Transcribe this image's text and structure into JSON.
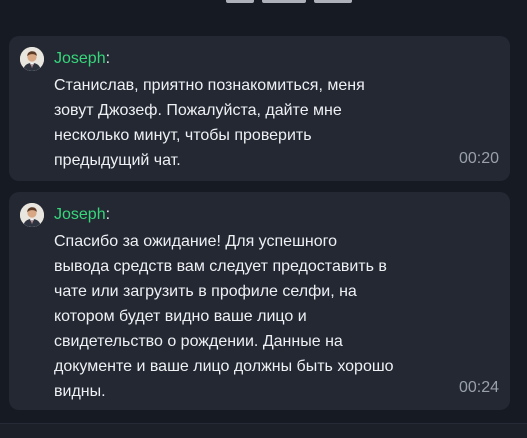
{
  "colors": {
    "background": "#151a23",
    "bubble": "#232833",
    "sender_name": "#37d67a",
    "message_text": "#eef0f3",
    "timestamp": "#9aa0aa"
  },
  "messages": [
    {
      "avatar_icon": "user-avatar-icon",
      "sender": "Joseph",
      "separator": ":",
      "lines": [
        "Станислав, приятно познакомиться, меня",
        "зовут Джозеф. Пожалуйста, дайте мне",
        "несколько минут, чтобы проверить",
        "предыдущий чат."
      ],
      "time": "00:20"
    },
    {
      "avatar_icon": "user-avatar-icon",
      "sender": "Joseph",
      "separator": ":",
      "lines": [
        "Спасибо за ожидание! Для успешного",
        "вывода средств вам следует предоставить в",
        "чате или загрузить в профиле селфи, на",
        "котором будет видно ваше лицо и",
        "свидетельство о рождении. Данные на",
        "документе и ваше лицо должны быть хорошо",
        "видны."
      ],
      "time": "00:24"
    }
  ]
}
